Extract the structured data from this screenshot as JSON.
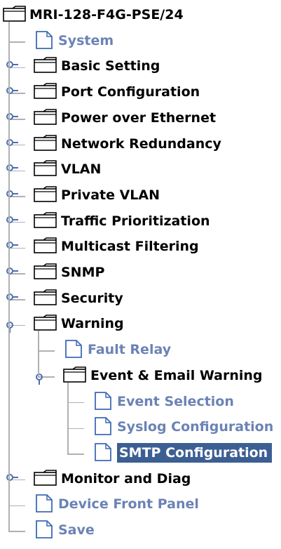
{
  "tree": {
    "root": {
      "label": "MRI-128-F4G-PSE/24",
      "icon": "folder-icon"
    },
    "items": [
      {
        "label": "System",
        "type": "page",
        "icon": "page-icon"
      },
      {
        "label": "Basic Setting",
        "type": "folder",
        "icon": "folder-icon",
        "expanded": false
      },
      {
        "label": "Port Configuration",
        "type": "folder",
        "icon": "folder-icon",
        "expanded": false
      },
      {
        "label": "Power over Ethernet",
        "type": "folder",
        "icon": "folder-icon",
        "expanded": false
      },
      {
        "label": "Network Redundancy",
        "type": "folder",
        "icon": "folder-icon",
        "expanded": false
      },
      {
        "label": "VLAN",
        "type": "folder",
        "icon": "folder-icon",
        "expanded": false
      },
      {
        "label": "Private VLAN",
        "type": "folder",
        "icon": "folder-icon",
        "expanded": false
      },
      {
        "label": "Traffic Prioritization",
        "type": "folder",
        "icon": "folder-icon",
        "expanded": false
      },
      {
        "label": "Multicast Filtering",
        "type": "folder",
        "icon": "folder-icon",
        "expanded": false
      },
      {
        "label": "SNMP",
        "type": "folder",
        "icon": "folder-icon",
        "expanded": false
      },
      {
        "label": "Security",
        "type": "folder",
        "icon": "folder-icon",
        "expanded": false
      },
      {
        "label": "Warning",
        "type": "folder",
        "icon": "folder-icon",
        "expanded": true,
        "children": [
          {
            "label": "Fault Relay",
            "type": "page",
            "icon": "page-icon"
          },
          {
            "label": "Event & Email Warning",
            "type": "folder",
            "icon": "folder-icon",
            "expanded": true,
            "children": [
              {
                "label": "Event Selection",
                "type": "page",
                "icon": "page-icon"
              },
              {
                "label": "Syslog Configuration",
                "type": "page",
                "icon": "page-icon"
              },
              {
                "label": "SMTP Configuration",
                "type": "page",
                "icon": "page-icon",
                "selected": true
              }
            ]
          }
        ]
      },
      {
        "label": "Monitor and Diag",
        "type": "folder",
        "icon": "folder-icon",
        "expanded": false
      },
      {
        "label": "Device Front Panel",
        "type": "page",
        "icon": "page-icon"
      },
      {
        "label": "Save",
        "type": "page",
        "icon": "page-icon"
      }
    ]
  },
  "colors": {
    "folder_text": "#000000",
    "page_text": "#6b83b5",
    "selected_background": "#3c5f93",
    "selected_text": "#ffffff",
    "tree_lines": "#b0b0b0",
    "toggle_icon": "#4a6fb0"
  }
}
